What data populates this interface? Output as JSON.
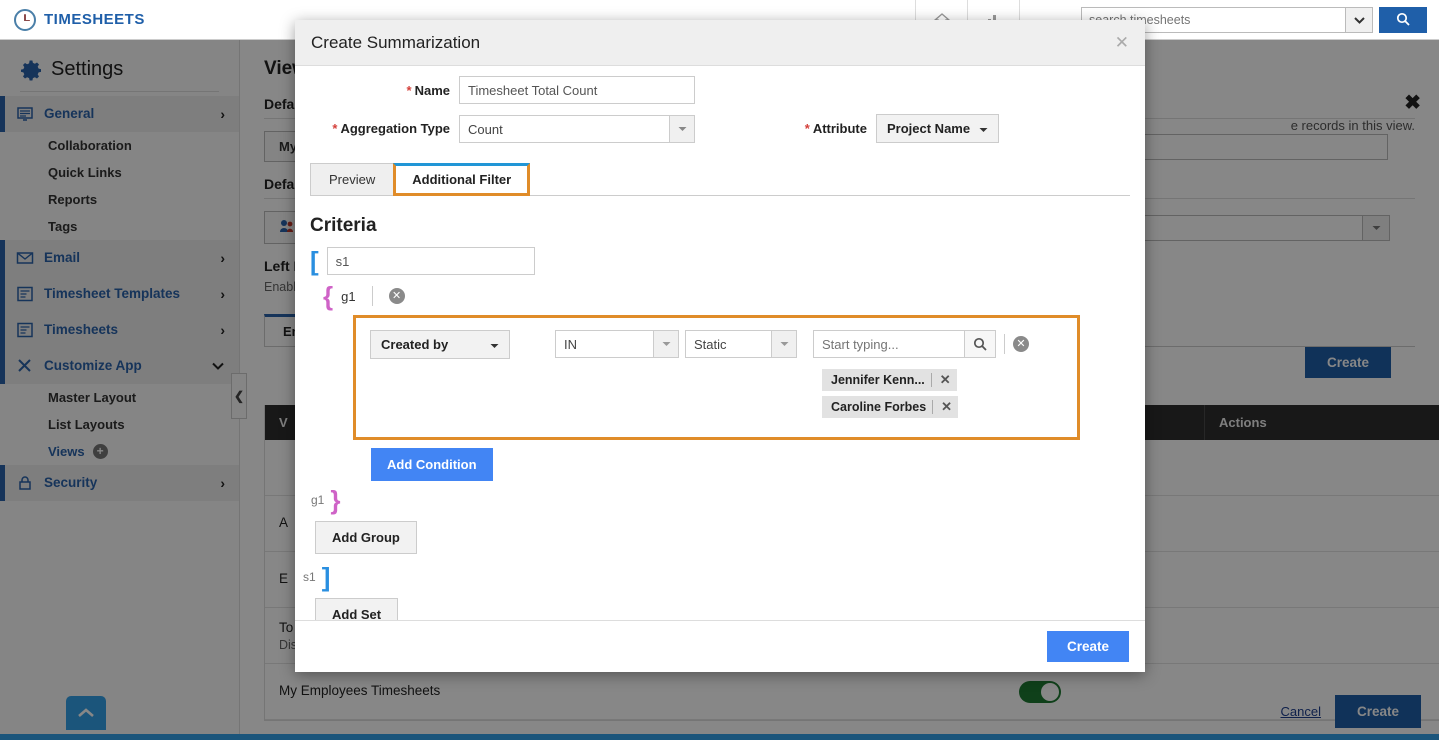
{
  "app": {
    "brand": "TIMESHEETS",
    "search": {
      "placeholder": "search timesheets",
      "value": ""
    },
    "icons": {
      "home": "home-icon",
      "chart": "chart-icon",
      "search": "search-icon",
      "caret": "chevron-down-icon"
    }
  },
  "sidebar": {
    "heading": "Settings",
    "items": [
      {
        "label": "General",
        "type": "group",
        "active": true,
        "icon": "general-icon",
        "chevron": "›"
      },
      {
        "label": "Collaboration",
        "type": "sub"
      },
      {
        "label": "Quick Links",
        "type": "sub"
      },
      {
        "label": "Reports",
        "type": "sub"
      },
      {
        "label": "Tags",
        "type": "sub"
      },
      {
        "label": "Email",
        "type": "group",
        "active": true,
        "icon": "email-icon",
        "chevron": "›"
      },
      {
        "label": "Timesheet Templates",
        "type": "group",
        "active": true,
        "icon": "template-icon",
        "chevron": "›"
      },
      {
        "label": "Timesheets",
        "type": "group",
        "active": true,
        "icon": "timesheet-icon",
        "chevron": "›"
      },
      {
        "label": "Customize App",
        "type": "group",
        "active": true,
        "icon": "tools-icon",
        "chevron": "⌄"
      },
      {
        "label": "Master Layout",
        "type": "sub"
      },
      {
        "label": "List Layouts",
        "type": "sub"
      },
      {
        "label": "Views",
        "type": "sub-link",
        "badge": "+"
      },
      {
        "label": "Security",
        "type": "group",
        "active": true,
        "icon": "lock-icon",
        "chevron": "›"
      }
    ]
  },
  "content": {
    "title": "View",
    "note": "e records in this view.",
    "close_icon": "close-icon",
    "default_label_1": "Defaul",
    "default_label_2": "Defaul",
    "left_panel_label": "Left Pa",
    "left_panel_desc": "Enable a",
    "my_button": "My T",
    "collab_button": "C",
    "tab_enable": "Ena",
    "create_button": "Create",
    "table": {
      "headers": [
        "V",
        "",
        "Actions"
      ],
      "rows": [
        {
          "name": "",
          "desc": ""
        },
        {
          "name": "A",
          "desc": ""
        },
        {
          "name": "E",
          "desc": ""
        },
        {
          "name": "To Follow Up",
          "desc": "Displays timesheets to follow up"
        },
        {
          "name": "My Employees Timesheets",
          "desc": ""
        }
      ]
    },
    "footer": {
      "cancel": "Cancel",
      "create": "Create"
    },
    "scroll_top_icon": "chevron-up-icon",
    "panel_handle_icon": "chevron-left-icon"
  },
  "modal": {
    "title": "Create Summarization",
    "close_icon": "close-icon",
    "fields": {
      "name_label": "Name",
      "name_value": "Timesheet Total Count",
      "aggregation_label": "Aggregation Type",
      "aggregation_value": "Count",
      "attribute_label": "Attribute",
      "attribute_value": "Project Name",
      "required_marker": "*"
    },
    "tabs": [
      {
        "label": "Preview",
        "selected": false
      },
      {
        "label": "Additional Filter",
        "selected": true
      }
    ],
    "criteria": {
      "heading": "Criteria",
      "set": {
        "open_bracket": "[",
        "close_bracket": "]",
        "name": "s1",
        "label": "s1"
      },
      "group": {
        "open_bracket": "{",
        "close_bracket": "}",
        "name": "g1",
        "label": "g1",
        "clear_icon": "clear-icon"
      },
      "condition": {
        "field": "Created by",
        "operator": "IN",
        "value_type": "Static",
        "search_placeholder": "Start typing...",
        "search_value": "",
        "search_icon": "search-icon",
        "clear_icon": "clear-icon",
        "chips": [
          {
            "label": "Jennifer Kenn...",
            "remove_icon": "close-icon"
          },
          {
            "label": "Caroline Forbes",
            "remove_icon": "close-icon"
          }
        ]
      },
      "buttons": {
        "add_condition": "Add Condition",
        "add_group": "Add Group",
        "add_set": "Add Set"
      }
    },
    "footer": {
      "create": "Create"
    }
  },
  "colors": {
    "brand_blue": "#1f5fa9",
    "accent_orange": "#e08c29",
    "primary_blue": "#4285f4",
    "tab_blue": "#2196d6",
    "bracket_blue": "#2a8fe0",
    "bracket_pink": "#cf63c7",
    "toggle_green": "#1e7a32"
  }
}
